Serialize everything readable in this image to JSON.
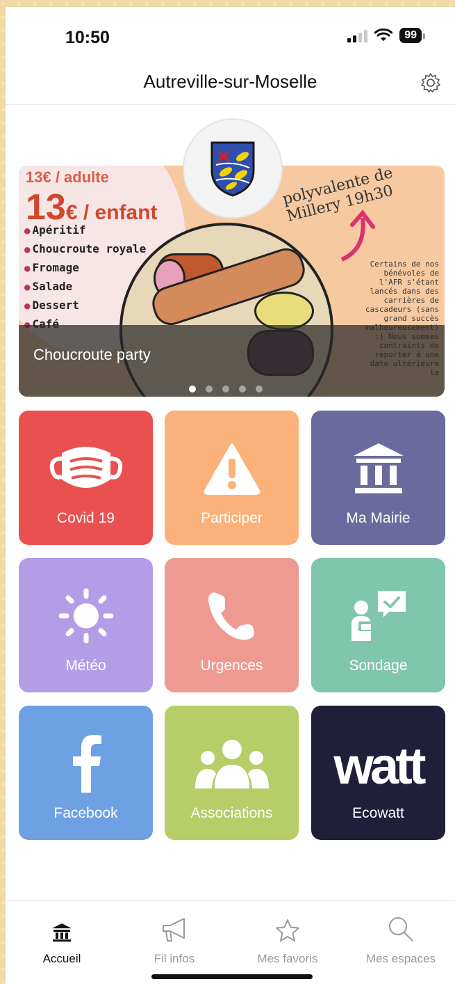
{
  "status_bar": {
    "time": "10:50",
    "battery": "99"
  },
  "header": {
    "title": "Autreville-sur-Moselle"
  },
  "banner": {
    "poster_price_adult": "13€ / adulte",
    "poster_price_child_amount": "13",
    "poster_price_child_unit": "€ / enfant",
    "poster_menu": [
      "Apéritif",
      "Choucroute royale",
      "Fromage",
      "Salade",
      "Dessert",
      "Café"
    ],
    "poster_venue": "polyvalente de Millery 19h30",
    "poster_side_text": "Certains de nos bénévoles de l'AFR s'étant lancés dans des carrières de cascadeurs (sans grand succès malheureusement) :) Nous sommes contraints de reporter à une date ultérieure la",
    "caption": "Choucroute party",
    "slide_count": 5,
    "active_slide": 1
  },
  "tiles": [
    {
      "label": "Covid 19",
      "icon": "mask-icon",
      "color": "#ea5050"
    },
    {
      "label": "Participer",
      "icon": "warning-icon",
      "color": "#fbb27a"
    },
    {
      "label": "Ma Mairie",
      "icon": "town-hall-icon",
      "color": "#6b6a9e"
    },
    {
      "label": "Météo",
      "icon": "sun-icon",
      "color": "#b39de6"
    },
    {
      "label": "Urgences",
      "icon": "phone-icon",
      "color": "#ee9a92"
    },
    {
      "label": "Sondage",
      "icon": "survey-icon",
      "color": "#80c6ad"
    },
    {
      "label": "Facebook",
      "icon": "facebook-icon",
      "color": "#6da1e3"
    },
    {
      "label": "Associations",
      "icon": "group-icon",
      "color": "#b6cd68"
    },
    {
      "label": "Ecowatt",
      "icon": "watt-logo",
      "logo_text": "watt",
      "color": "#1f1f3a"
    }
  ],
  "bottom_nav": [
    {
      "label": "Accueil",
      "icon": "town-hall-icon",
      "active": true
    },
    {
      "label": "Fil infos",
      "icon": "megaphone-icon",
      "active": false
    },
    {
      "label": "Mes favoris",
      "icon": "star-icon",
      "active": false
    },
    {
      "label": "Mes espaces",
      "icon": "search-icon",
      "active": false
    }
  ]
}
